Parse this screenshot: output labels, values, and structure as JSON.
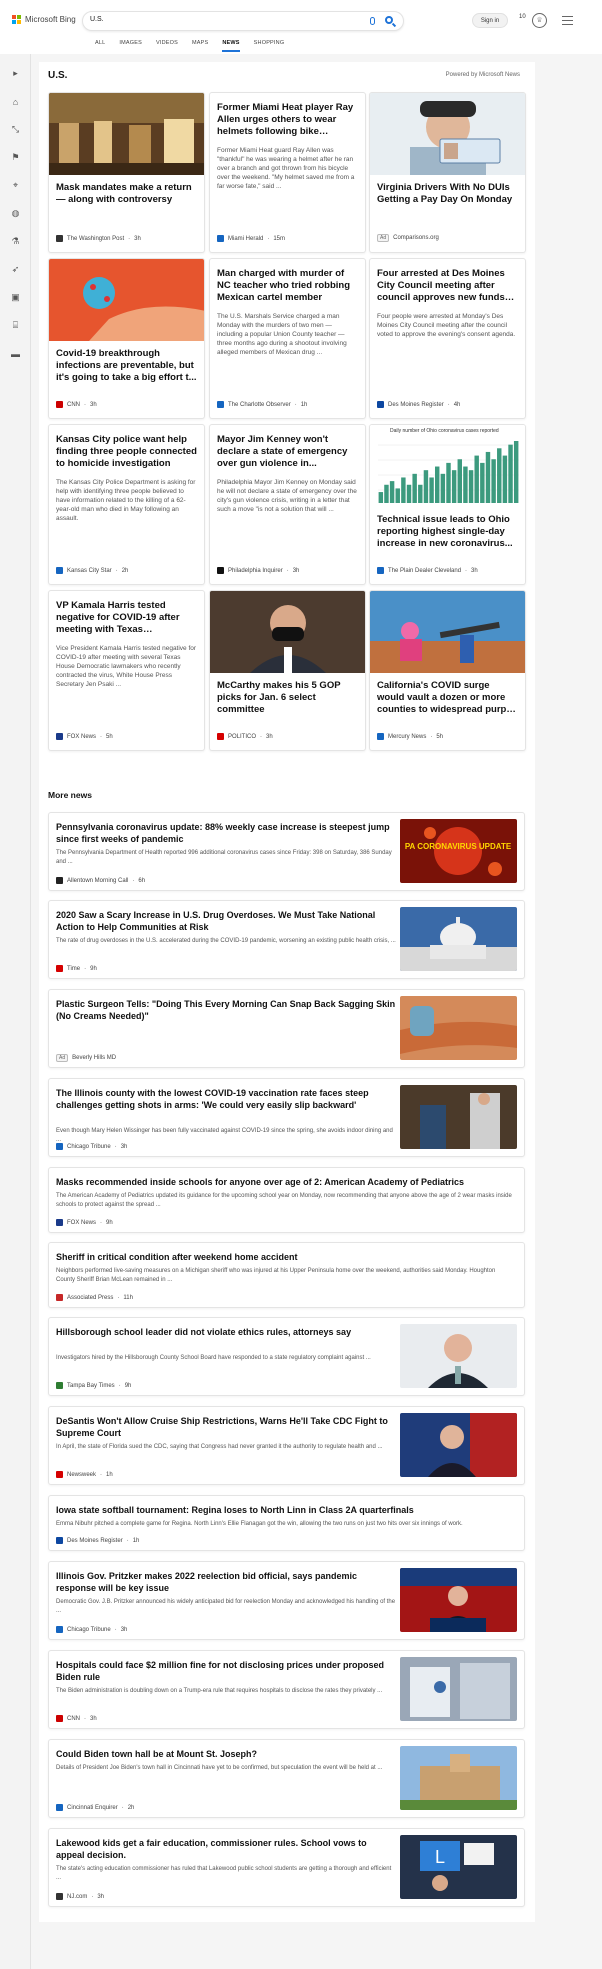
{
  "header": {
    "brand": "Microsoft Bing",
    "search_value": "U.S.",
    "signin": "Sign in",
    "rewards_count": "10",
    "tabs": [
      {
        "label": "ALL"
      },
      {
        "label": "IMAGES"
      },
      {
        "label": "VIDEOS"
      },
      {
        "label": "MAPS"
      },
      {
        "label": "NEWS",
        "active": true
      },
      {
        "label": "SHOPPING"
      }
    ]
  },
  "section": {
    "title": "U.S.",
    "powered_by": "Powered by Microsoft News"
  },
  "top_cards": [
    {
      "title": "Mask mandates make a return — along with controversy",
      "snippet": "",
      "source": "The Washington Post",
      "time": "3h",
      "logo_color": "#333333"
    },
    {
      "title": "Former Miami Heat player Ray Allen urges others to wear helmets following bike accident",
      "snippet": "Former Miami Heat guard Ray Allen was \"thankful\" he was wearing a helmet after he ran over a branch and got thrown from his bicycle over the weekend. \"My helmet saved me from a far worse fate,\" said ...",
      "source": "Miami Herald",
      "time": "15m",
      "logo_color": "#1565c0"
    },
    {
      "title": "Virginia Drivers With No DUIs Getting a Pay Day On Monday",
      "snippet": "",
      "source": "Comparisons.org",
      "time": "",
      "ad": "Ad",
      "logo_color": ""
    },
    {
      "title": "Covid-19 breakthrough infections are preventable, but it's going to take a big effort t...",
      "snippet": "",
      "source": "CNN",
      "time": "3h",
      "logo_color": "#cc0000"
    },
    {
      "title": "Man charged with murder of NC teacher who tried robbing Mexican cartel member",
      "snippet": "The U.S. Marshals Service charged a man Monday with the murders of two men — including a popular Union County teacher — three months ago during a shootout involving alleged members of Mexican drug ...",
      "source": "The Charlotte Observer",
      "time": "1h",
      "logo_color": "#1565c0"
    },
    {
      "title": "Four arrested at Des Moines City Council meeting after council approves new funds f...",
      "snippet": "Four people were arrested at Monday's Des Moines City Council meeting after the council voted to approve the evening's consent agenda.",
      "source": "Des Moines Register",
      "time": "4h",
      "logo_color": "#0d47a1"
    },
    {
      "title": "Kansas City police want help finding three people connected to homicide investigation",
      "snippet": "The Kansas City Police Department is asking for help with identifying three people believed to have information related to the killing of a 62-year-old man who died in May following an assault.",
      "source": "Kansas City Star",
      "time": "2h",
      "logo_color": "#1565c0"
    },
    {
      "title": "Mayor Jim Kenney won't declare a state of emergency over gun violence in...",
      "snippet": "Philadelphia Mayor Jim Kenney on Monday said he will not declare a state of emergency over the city's gun violence crisis, writing in a letter that such a move \"is not a solution that will ...",
      "source": "Philadelphia Inquirer",
      "time": "3h",
      "logo_color": "#111111"
    },
    {
      "title": "Technical issue leads to Ohio reporting highest single-day increase in new coronavirus...",
      "snippet": "",
      "source": "The Plain Dealer Cleveland",
      "time": "3h",
      "logo_color": "#1565c0",
      "chart_caption": "Daily number of Ohio coronavirus cases reported"
    },
    {
      "title": "VP Kamala Harris tested negative for COVID-19 after meeting with Texas Democrat...",
      "snippet": "Vice President Kamala Harris tested negative for COVID-19 after meeting with several Texas House Democratic lawmakers who recently contracted the virus, White House Press Secretary Jen Psaki ...",
      "source": "FOX News",
      "time": "5h",
      "logo_color": "#1a3a8a"
    },
    {
      "title": "McCarthy makes his 5 GOP picks for Jan. 6 select committee",
      "snippet": "",
      "source": "POLITICO",
      "time": "3h",
      "logo_color": "#d50000"
    },
    {
      "title": "California's COVID surge would vault a dozen or more counties to widespread purple tier",
      "snippet": "",
      "source": "Mercury News",
      "time": "5h",
      "logo_color": "#1565c0"
    }
  ],
  "more_news": {
    "title": "More news",
    "items": [
      {
        "title": "Pennsylvania coronavirus update: 88% weekly case increase is steepest jump since first weeks of pandemic",
        "snippet": "The Pennsylvania Department of Health reported 996 additional coronavirus cases since Friday: 398 on Saturday, 386 Sunday and ...",
        "source": "Allentown Morning Call",
        "time": "6h",
        "logo_color": "#222222",
        "thumb_text": "PA CORONAVIRUS UPDATE"
      },
      {
        "title": "2020 Saw a Scary Increase in U.S. Drug Overdoses. We Must Take National Action to Help Communities at Risk",
        "snippet": "The rate of drug overdoses in the U.S. accelerated during the COVID-19 pandemic, worsening an existing public health crisis, ...",
        "source": "Time",
        "time": "9h",
        "logo_color": "#d50000"
      },
      {
        "title": "Plastic Surgeon Tells: \"Doing This Every Morning Can Snap Back Sagging Skin (No Creams Needed)\"",
        "snippet": "",
        "source": "Beverly Hills MD",
        "time": "",
        "ad": "Ad",
        "logo_color": ""
      },
      {
        "title": "The Illinois county with the lowest COVID-19 vaccination rate faces steep challenges getting shots in arms: 'We could very easily slip backward'",
        "snippet": "Even though Mary Helen Wissinger has been fully vaccinated against COVID-19 since the spring, she avoids indoor dining and ...",
        "source": "Chicago Tribune",
        "time": "3h",
        "logo_color": "#1565c0"
      },
      {
        "title": "Masks recommended inside schools for anyone over age of 2: American Academy of Pediatrics",
        "snippet": "The American Academy of Pediatrics updated its guidance for the upcoming school year on Monday, now recommending that anyone above the age of 2 wear masks inside schools to protect against the spread ...",
        "source": "FOX News",
        "time": "9h",
        "logo_color": "#1a3a8a"
      },
      {
        "title": "Sheriff in critical condition after weekend home accident",
        "snippet": "Neighbors performed live-saving measures on a Michigan sheriff who was injured at his Upper Peninsula home over the weekend, authorities said Monday. Houghton County Sheriff Brian McLean remained in ...",
        "source": "Associated Press",
        "time": "11h",
        "logo_color": "#c62828"
      },
      {
        "title": "Hillsborough school leader did not violate ethics rules, attorneys say",
        "snippet": "Investigators hired by the Hillsborough County School Board have responded to a state regulatory complaint against ...",
        "source": "Tampa Bay Times",
        "time": "9h",
        "logo_color": "#2e7d32"
      },
      {
        "title": "DeSantis Won't Allow Cruise Ship Restrictions, Warns He'll Take CDC Fight to Supreme Court",
        "snippet": "In April, the state of Florida sued the CDC, saying that Congress had never granted it the authority to regulate health and ...",
        "source": "Newsweek",
        "time": "1h",
        "logo_color": "#d50000"
      },
      {
        "title": "Iowa state softball tournament: Regina loses to North Linn in Class 2A quarterfinals",
        "snippet": "Emma Nibuhr pitched a complete game for Regina. North Linn's Ellie Flanagan got the win, allowing the two runs on just two hits over six innings of work.",
        "source": "Des Moines Register",
        "time": "1h",
        "logo_color": "#0d47a1"
      },
      {
        "title": "Illinois Gov. Pritzker makes 2022 reelection bid official, says pandemic response will be key issue",
        "snippet": "Democratic Gov. J.B. Pritzker announced his widely anticipated bid for reelection Monday and acknowledged his handling of the ...",
        "source": "Chicago Tribune",
        "time": "3h",
        "logo_color": "#1565c0"
      },
      {
        "title": "Hospitals could face $2 million fine for not disclosing prices under proposed Biden rule",
        "snippet": "The Biden administration is doubling down on a Trump-era rule that requires hospitals to disclose the rates they privately ...",
        "source": "CNN",
        "time": "3h",
        "logo_color": "#cc0000"
      },
      {
        "title": "Could Biden town hall be at Mount St. Joseph?",
        "snippet": "Details of President Joe Biden's town hall in Cincinnati have yet to be confirmed, but speculation the event will be held at ...",
        "source": "Cincinnati Enquirer",
        "time": "2h",
        "logo_color": "#1565c0"
      },
      {
        "title": "Lakewood kids get a fair education, commissioner rules. School vows to appeal decision.",
        "snippet": "The state's acting education commissioner has ruled that Lakewood public school students are getting a thorough and efficient ...",
        "source": "NJ.com",
        "time": "3h",
        "logo_color": "#333333"
      }
    ]
  },
  "sidebar_icons": [
    "chevron-right-icon",
    "home-icon",
    "resize-icon",
    "flag-icon",
    "location-icon",
    "globe-icon",
    "science-icon",
    "rocket-icon",
    "tv-icon",
    "bank-icon",
    "car-icon"
  ],
  "chart_data": {
    "type": "bar",
    "title": "Daily number of Ohio coronavirus cases reported",
    "categories": [],
    "values": [
      3,
      5,
      6,
      4,
      7,
      5,
      8,
      5,
      9,
      7,
      10,
      8,
      11,
      9,
      12,
      10,
      9,
      13,
      11,
      14,
      12,
      15,
      13,
      16,
      17
    ]
  }
}
